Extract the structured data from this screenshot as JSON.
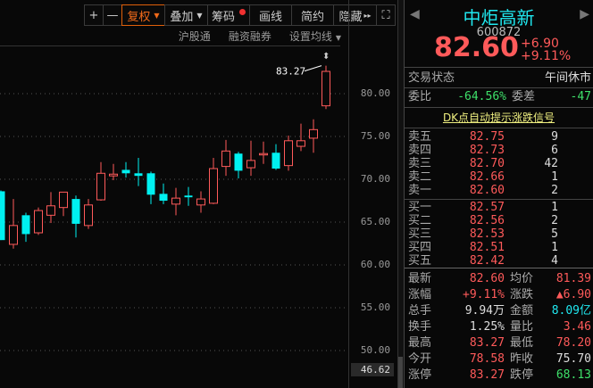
{
  "toolbar": {
    "zoom_in": "+",
    "zoom_out": "—",
    "fuquan": "复权",
    "overlay": "叠加",
    "chips": "筹码",
    "draw": "画线",
    "simple": "简约",
    "hide": "隐藏",
    "hide_arrow": "▸▸",
    "fullscreen": "⛶"
  },
  "subbar": {
    "hgt": "沪股通",
    "margin": "融资融券",
    "ma": "设置均线"
  },
  "colors": {
    "up": "#ff5a5a",
    "down": "#00f0f0",
    "accent": "#f06a1a"
  },
  "axis": {
    "ticks": [
      "80.00",
      "75.00",
      "70.00",
      "65.00",
      "60.00",
      "55.00",
      "50.00"
    ],
    "current": "46.62"
  },
  "chart_data": {
    "type": "candlestick",
    "high_label": "83.27",
    "ylim": [
      46,
      84
    ],
    "ohlc": [
      [
        68.6,
        68.7,
        62.9,
        62.9
      ],
      [
        62.4,
        67.7,
        61.9,
        64.6
      ],
      [
        65.8,
        66.1,
        62.7,
        63.6
      ],
      [
        63.75,
        66.7,
        63.5,
        66.35
      ],
      [
        65.8,
        68.5,
        64.9,
        66.9
      ],
      [
        66.7,
        68.5,
        65.7,
        68.5
      ],
      [
        67.7,
        68.1,
        63.2,
        64.8
      ],
      [
        64.6,
        67.7,
        64.2,
        67.0
      ],
      [
        67.6,
        72.0,
        67.5,
        70.7
      ],
      [
        70.4,
        71.8,
        69.9,
        70.6
      ],
      [
        71.1,
        72.0,
        70.2,
        70.7
      ],
      [
        70.7,
        72.5,
        69.2,
        70.4
      ],
      [
        70.7,
        70.9,
        67.1,
        68.2
      ],
      [
        68.3,
        69.5,
        67.1,
        67.5
      ],
      [
        67.1,
        69.0,
        65.8,
        67.8
      ],
      [
        68.1,
        69.1,
        66.9,
        67.9
      ],
      [
        67.0,
        68.6,
        66.1,
        67.7
      ],
      [
        67.2,
        72.5,
        67.1,
        71.25
      ],
      [
        71.5,
        74.6,
        70.4,
        73.3
      ],
      [
        73.0,
        73.2,
        70.1,
        71.0
      ],
      [
        71.35,
        74.5,
        70.4,
        72.2
      ],
      [
        72.95,
        74.4,
        71.8,
        73.0
      ],
      [
        73.1,
        74.1,
        71.1,
        71.25
      ],
      [
        71.6,
        75.1,
        71.0,
        74.5
      ],
      [
        73.85,
        76.5,
        73.3,
        74.5
      ],
      [
        74.8,
        77.0,
        73.1,
        75.8
      ],
      [
        78.58,
        83.27,
        78.2,
        82.6
      ]
    ]
  },
  "quote": {
    "name": "中炬高新",
    "code": "600872",
    "price": "82.60",
    "change": "+6.90",
    "pct": "+9.11%"
  },
  "status": {
    "label": "交易状态",
    "value": "午间休市"
  },
  "weibi": {
    "label": "委比",
    "value": "-64.56%",
    "diff_label": "委差",
    "diff": "-47"
  },
  "dk": "DK点自动提示涨跌信号",
  "asks": [
    {
      "label": "卖五",
      "price": "82.75",
      "vol": "9"
    },
    {
      "label": "卖四",
      "price": "82.73",
      "vol": "6"
    },
    {
      "label": "卖三",
      "price": "82.70",
      "vol": "42"
    },
    {
      "label": "卖二",
      "price": "82.66",
      "vol": "1"
    },
    {
      "label": "卖一",
      "price": "82.60",
      "vol": "2"
    }
  ],
  "bids": [
    {
      "label": "买一",
      "price": "82.57",
      "vol": "1"
    },
    {
      "label": "买二",
      "price": "82.56",
      "vol": "2"
    },
    {
      "label": "买三",
      "price": "82.53",
      "vol": "5"
    },
    {
      "label": "买四",
      "price": "82.51",
      "vol": "1"
    },
    {
      "label": "买五",
      "price": "82.42",
      "vol": "4"
    }
  ],
  "stats": [
    {
      "l1": "最新",
      "v1": "82.60",
      "c1": "red",
      "l2": "均价",
      "v2": "81.39",
      "c2": "red"
    },
    {
      "l1": "涨幅",
      "v1": "+9.11%",
      "c1": "red",
      "l2": "涨跌",
      "v2": "▲6.90",
      "c2": "red"
    },
    {
      "l1": "总手",
      "v1": "9.94万",
      "c1": "white",
      "l2": "金额",
      "v2": "8.09亿",
      "c2": "cyan"
    },
    {
      "l1": "换手",
      "v1": "1.25%",
      "c1": "white",
      "l2": "量比",
      "v2": "3.46",
      "c2": "red"
    },
    {
      "l1": "最高",
      "v1": "83.27",
      "c1": "red",
      "l2": "最低",
      "v2": "78.20",
      "c2": "red"
    },
    {
      "l1": "今开",
      "v1": "78.58",
      "c1": "red",
      "l2": "昨收",
      "v2": "75.70",
      "c2": "white"
    },
    {
      "l1": "涨停",
      "v1": "83.27",
      "c1": "red",
      "l2": "跌停",
      "v2": "68.13",
      "c2": "green"
    }
  ]
}
